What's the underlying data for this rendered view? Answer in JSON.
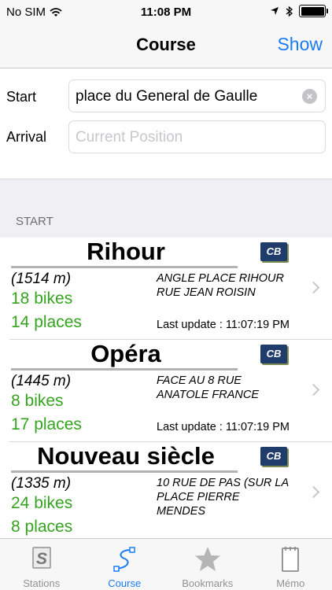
{
  "status_bar": {
    "carrier": "No SIM",
    "time": "11:08 PM"
  },
  "nav": {
    "title": "Course",
    "action": "Show"
  },
  "form": {
    "start_label": "Start",
    "start_value": "place du General de Gaulle",
    "arrival_label": "Arrival",
    "arrival_placeholder": "Current Position"
  },
  "section_header": "START",
  "stations": [
    {
      "name": "Rihour",
      "distance": "(1514 m)",
      "bikes": "18 bikes",
      "places": "14 places",
      "address": "ANGLE PLACE RIHOUR RUE JEAN ROISIN",
      "last_update": "Last update : 11:07:19 PM",
      "logo": "CB"
    },
    {
      "name": "Opéra",
      "distance": "(1445 m)",
      "bikes": "8 bikes",
      "places": "17 places",
      "address": "FACE AU 8 RUE ANATOLE FRANCE",
      "last_update": "Last update : 11:07:19 PM",
      "logo": "CB"
    },
    {
      "name": "Nouveau siècle",
      "distance": "(1335 m)",
      "bikes": "24 bikes",
      "places": "8 places",
      "address": "10 RUE DE PAS (SUR LA PLACE PIERRE MENDES",
      "last_update": "",
      "logo": "CB"
    }
  ],
  "tabs": [
    {
      "label": "Stations",
      "icon": "stations-s-icon",
      "active": false
    },
    {
      "label": "Course",
      "icon": "route-icon",
      "active": true
    },
    {
      "label": "Bookmarks",
      "icon": "star-icon",
      "active": false
    },
    {
      "label": "Mémo",
      "icon": "notepad-icon",
      "active": false
    }
  ],
  "colors": {
    "accent": "#1a7cf5",
    "available": "#34a41e",
    "inactive": "#929292"
  }
}
